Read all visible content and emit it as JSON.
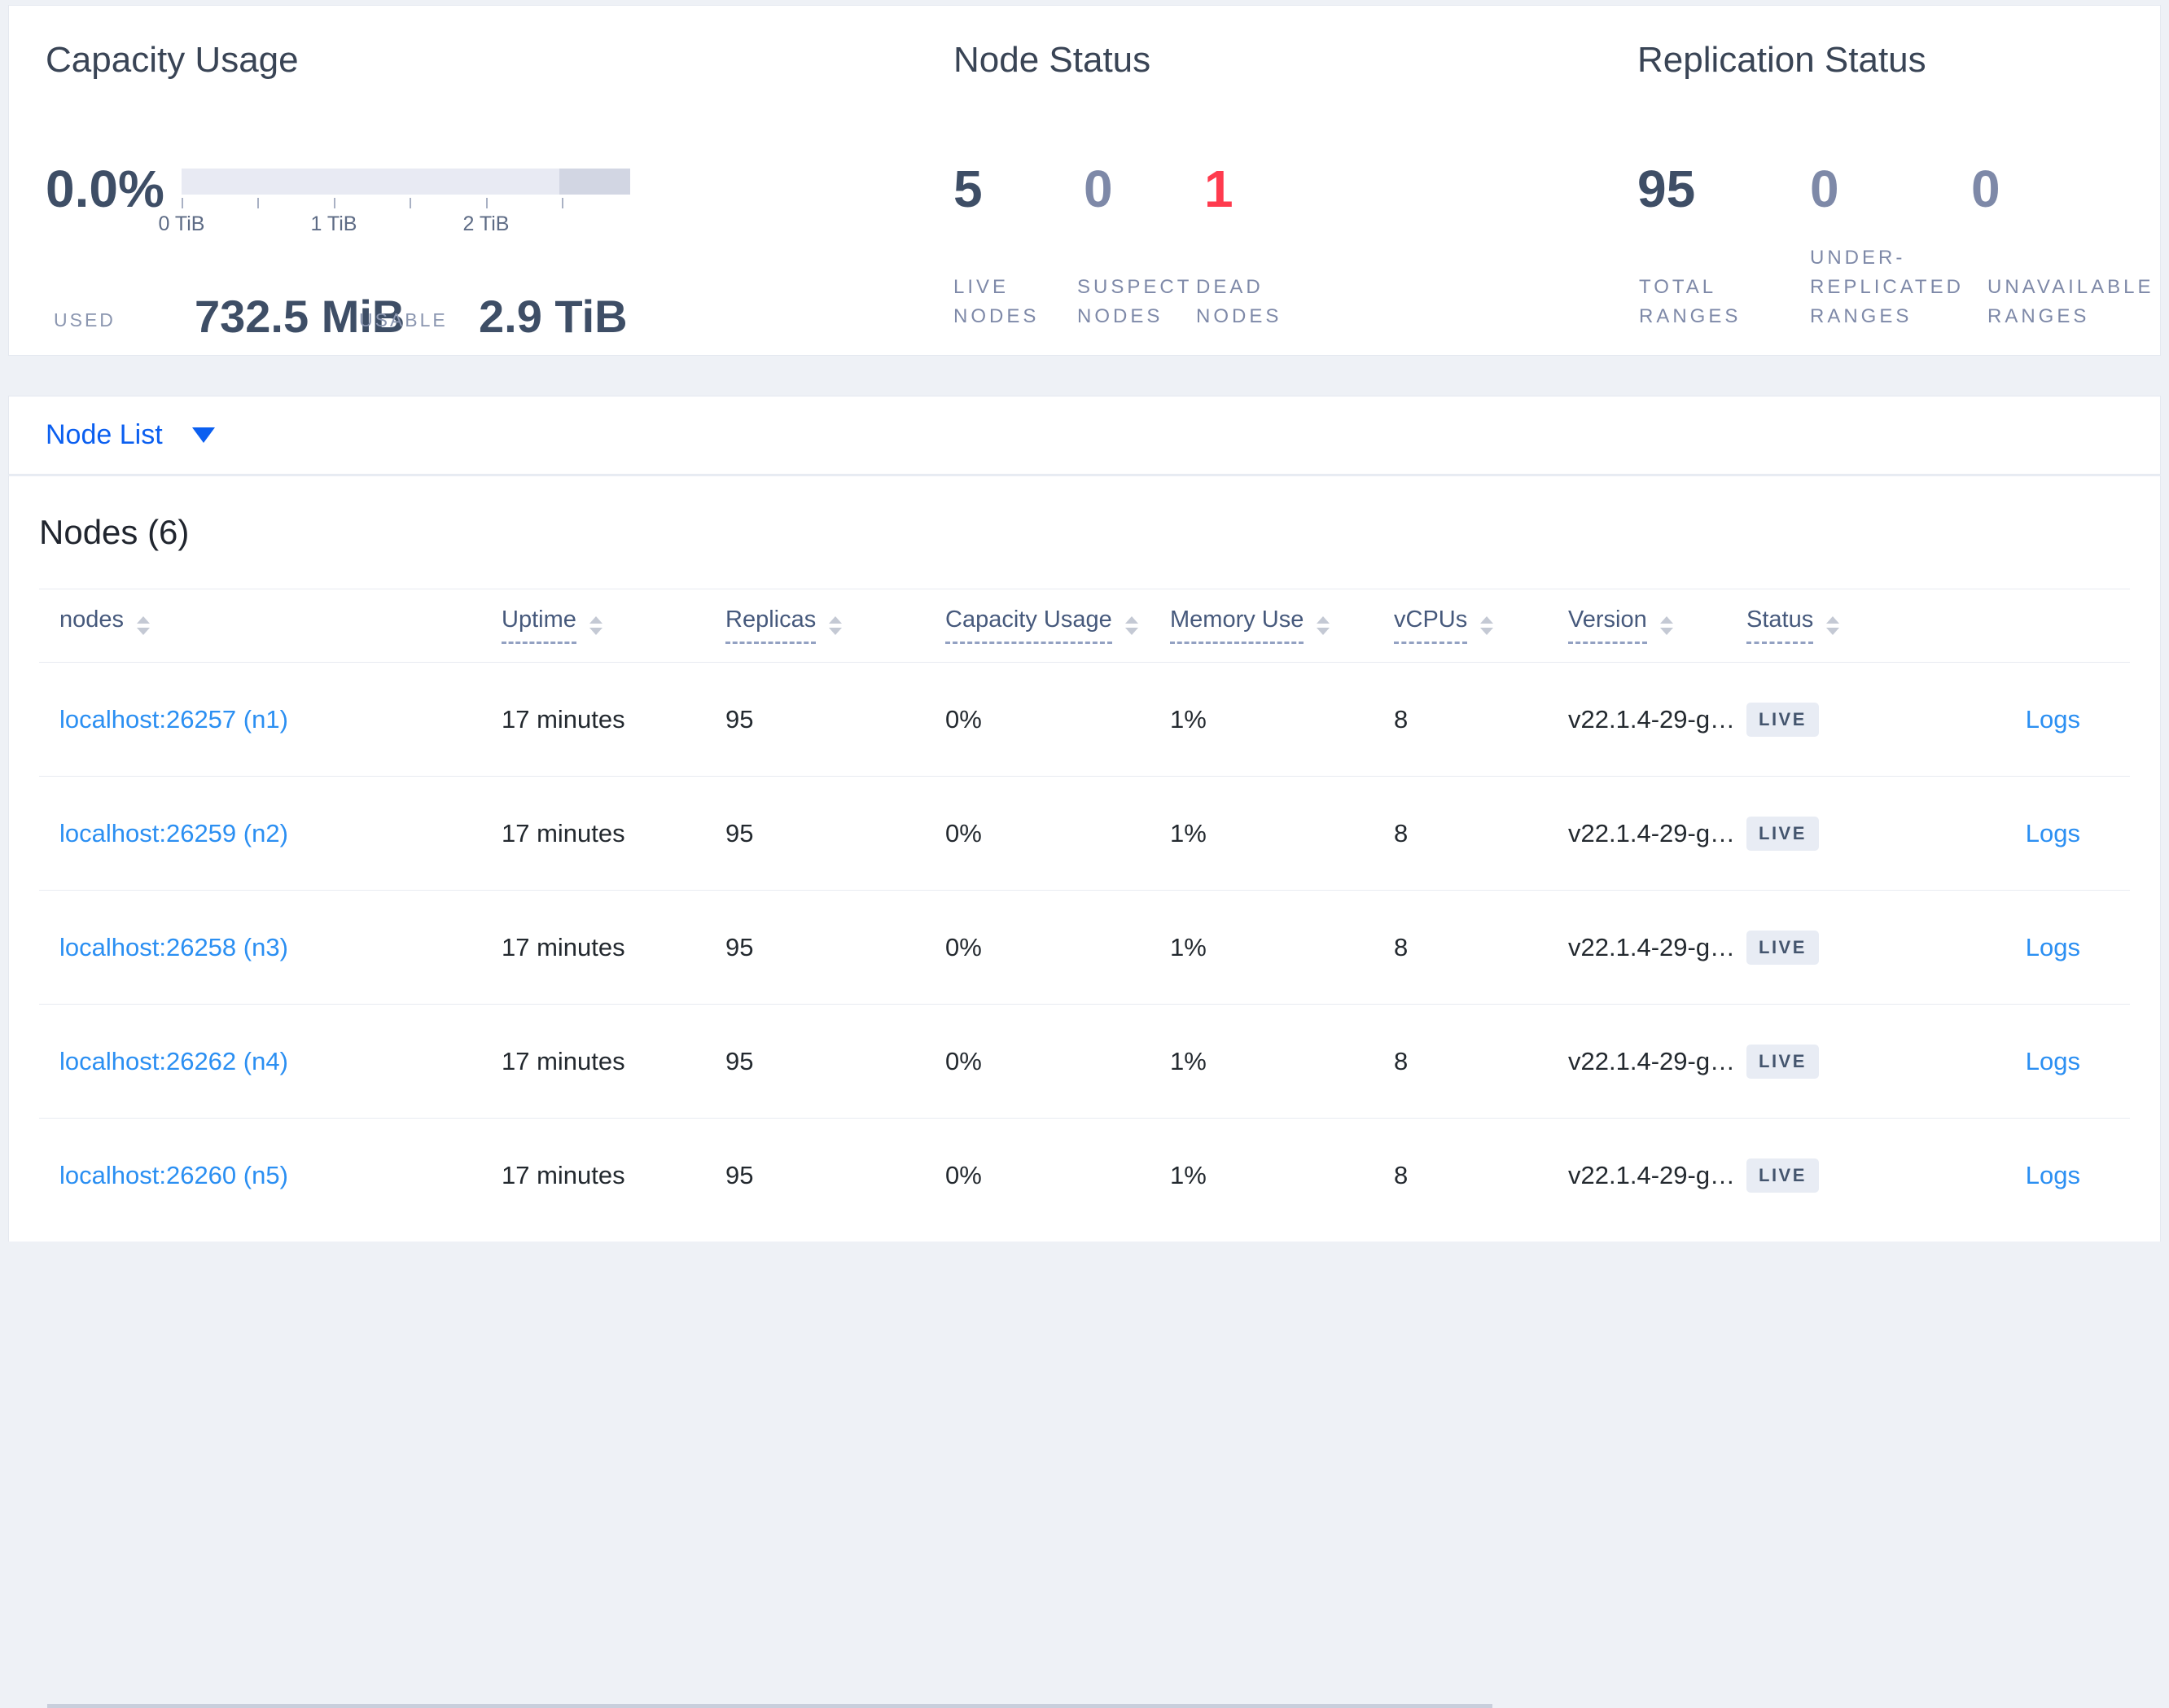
{
  "capacity": {
    "title": "Capacity Usage",
    "percent": "0.0%",
    "used_label": "USED",
    "used_value": "732.5 MiB",
    "usable_label": "USABLE",
    "usable_value": "2.9 TiB",
    "tick_labels": [
      "0 TiB",
      "1 TiB",
      "2 TiB"
    ],
    "bar": {
      "light_color": "#e8eaf3",
      "dark_color": "#d2d6e3",
      "dark_fraction": 0.16
    }
  },
  "node_status": {
    "title": "Node Status",
    "stats": [
      {
        "value": "5",
        "label": "LIVE NODES",
        "tone": "normal"
      },
      {
        "value": "0",
        "label": "SUSPECT NODES",
        "tone": "muted"
      },
      {
        "value": "1",
        "label": "DEAD NODES",
        "tone": "danger"
      }
    ],
    "danger_color": "#ff3b4e"
  },
  "replication_status": {
    "title": "Replication Status",
    "stats": [
      {
        "value": "95",
        "label": "TOTAL RANGES",
        "tone": "normal"
      },
      {
        "value": "0",
        "label": "UNDER-REPLICATED RANGES",
        "tone": "muted"
      },
      {
        "value": "0",
        "label": "UNAVAILABLE RANGES",
        "tone": "muted"
      }
    ]
  },
  "node_list": {
    "label": "Node List",
    "icon": "caret-down-icon"
  },
  "table": {
    "section_title": "Nodes (6)",
    "columns": [
      {
        "label": "nodes",
        "sortable": true,
        "underlined": false
      },
      {
        "label": "Uptime",
        "sortable": true,
        "underlined": true
      },
      {
        "label": "Replicas",
        "sortable": true,
        "underlined": true
      },
      {
        "label": "Capacity Usage",
        "sortable": true,
        "underlined": true
      },
      {
        "label": "Memory Use",
        "sortable": true,
        "underlined": true
      },
      {
        "label": "vCPUs",
        "sortable": true,
        "underlined": true
      },
      {
        "label": "Version",
        "sortable": true,
        "underlined": true
      },
      {
        "label": "Status",
        "sortable": true,
        "underlined": true
      }
    ],
    "rows": [
      {
        "address": "localhost:26257 (n1)",
        "uptime": "17 minutes",
        "replicas": "95",
        "capacity": "0%",
        "memory": "1%",
        "vcpus": "8",
        "version": "v22.1.4-29-g…",
        "status": "LIVE",
        "logs": "Logs"
      },
      {
        "address": "localhost:26259 (n2)",
        "uptime": "17 minutes",
        "replicas": "95",
        "capacity": "0%",
        "memory": "1%",
        "vcpus": "8",
        "version": "v22.1.4-29-g…",
        "status": "LIVE",
        "logs": "Logs"
      },
      {
        "address": "localhost:26258 (n3)",
        "uptime": "17 minutes",
        "replicas": "95",
        "capacity": "0%",
        "memory": "1%",
        "vcpus": "8",
        "version": "v22.1.4-29-g…",
        "status": "LIVE",
        "logs": "Logs"
      },
      {
        "address": "localhost:26262 (n4)",
        "uptime": "17 minutes",
        "replicas": "95",
        "capacity": "0%",
        "memory": "1%",
        "vcpus": "8",
        "version": "v22.1.4-29-g…",
        "status": "LIVE",
        "logs": "Logs"
      },
      {
        "address": "localhost:26260 (n5)",
        "uptime": "17 minutes",
        "replicas": "95",
        "capacity": "0%",
        "memory": "1%",
        "vcpus": "8",
        "version": "v22.1.4-29-g…",
        "status": "LIVE",
        "logs": "Logs"
      }
    ]
  }
}
